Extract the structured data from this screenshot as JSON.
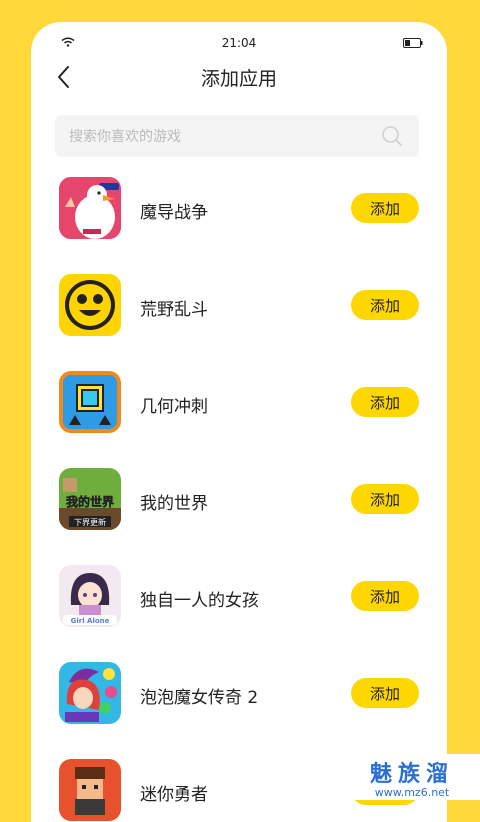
{
  "status": {
    "time": "21:04"
  },
  "header": {
    "title": "添加应用"
  },
  "search": {
    "placeholder": "搜索你喜欢的游戏"
  },
  "apps": [
    {
      "name": "魔导战争",
      "button": "添加"
    },
    {
      "name": "荒野乱斗",
      "button": "添加"
    },
    {
      "name": "几何冲刺",
      "button": "添加"
    },
    {
      "name": "我的世界",
      "button": "添加"
    },
    {
      "name": "独自一人的女孩",
      "button": "添加"
    },
    {
      "name": "泡泡魔女传奇 2",
      "button": "添加"
    },
    {
      "name": "迷你勇者",
      "button": "添加"
    }
  ],
  "watermark": {
    "name": "魅族溜",
    "url": "www.mz6.net"
  },
  "icon_texts": {
    "minecraft_title": "我的世界",
    "minecraft_sub": "下界更新",
    "girl_alone": "Girl Alone"
  },
  "colors": {
    "background": "#FFD93A",
    "button": "#FFD700",
    "accent": "#2A6FD4"
  }
}
